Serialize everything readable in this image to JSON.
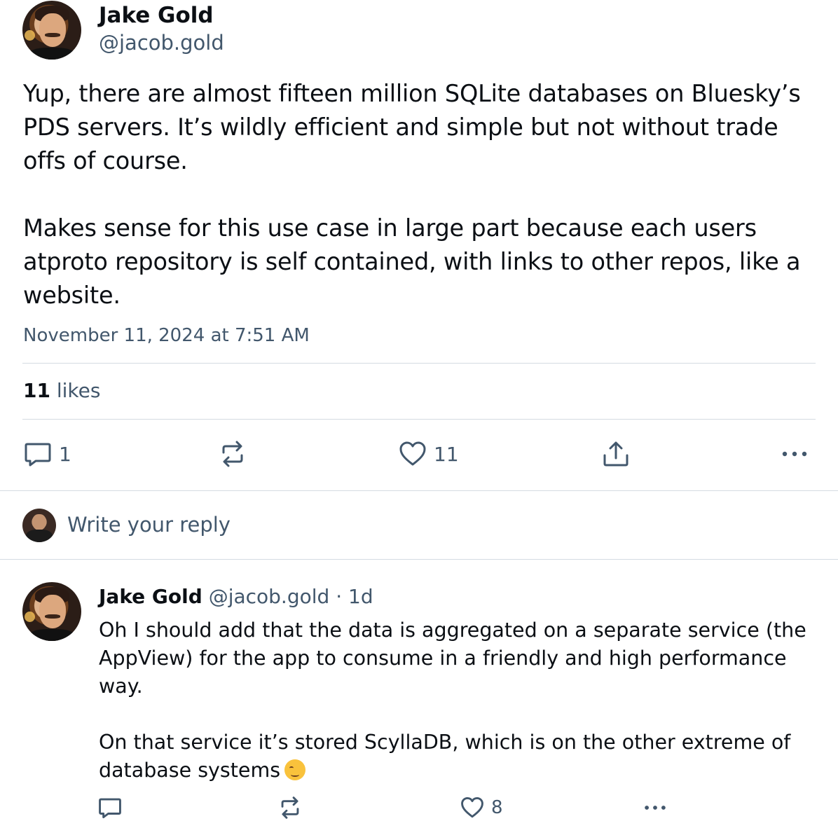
{
  "post": {
    "author_name": "Jake Gold",
    "author_handle": "@jacob.gold",
    "paragraphs": [
      "Yup, there are almost fifteen million SQLite databases on Bluesky’s PDS servers. It’s wildly efficient and simple but not without trade offs of course.",
      "Makes sense for this use case in large part because each users atproto repository is self contained, with links to other repos, like a website."
    ],
    "timestamp": "November 11, 2024 at 7:51 AM",
    "likes_count": "11",
    "likes_label": "likes",
    "actions": {
      "reply_count": "1",
      "like_count": "11"
    }
  },
  "composer": {
    "placeholder": "Write your reply"
  },
  "reply": {
    "author_name": "Jake Gold",
    "author_handle": "@jacob.gold",
    "separator": "·",
    "age": "1d",
    "paragraphs": [
      "Oh I should add that the data is aggregated on a separate service (the AppView) for the app to consume in a friendly and high performance way.",
      "On that service it’s stored ScyllaDB, which is on the other extreme of database systems"
    ],
    "emoji": "relieved-face",
    "actions": {
      "like_count": "8"
    }
  },
  "colors": {
    "text": "#0b0f14",
    "muted": "#42576c",
    "divider": "#d4dbe2"
  }
}
